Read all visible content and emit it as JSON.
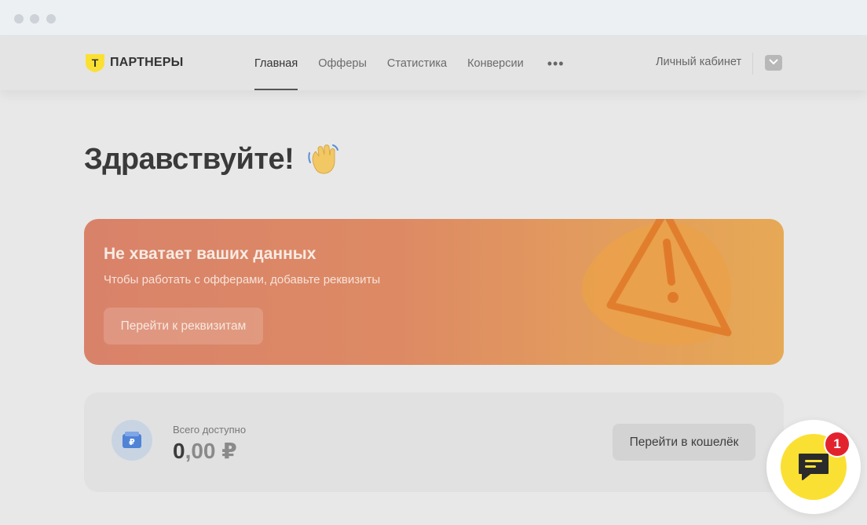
{
  "header": {
    "logo_text": "ПАРТНЕРЫ",
    "logo_letter": "Т",
    "nav": [
      {
        "label": "Главная",
        "active": true
      },
      {
        "label": "Офферы",
        "active": false
      },
      {
        "label": "Статистика",
        "active": false
      },
      {
        "label": "Конверсии",
        "active": false
      }
    ],
    "more": "•••",
    "cabinet_label": "Личный кабинет"
  },
  "greeting": {
    "title": "Здравствуйте!",
    "emoji": "👋"
  },
  "alert": {
    "title": "Не хватает ваших данных",
    "subtitle": "Чтобы работать с офферами, добавьте реквизиты",
    "button_label": "Перейти к реквизитам"
  },
  "wallet": {
    "label": "Всего доступно",
    "amount_int": "0",
    "amount_dec": ",00",
    "currency": " ₽",
    "button_label": "Перейти в кошелёк"
  },
  "chat": {
    "badge": "1"
  },
  "colors": {
    "brand_yellow": "#fbe034",
    "badge_red": "#e2232e",
    "alert_start": "#d9826a",
    "alert_end": "#e6a955"
  }
}
